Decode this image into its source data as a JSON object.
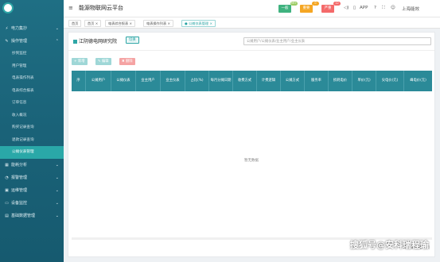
{
  "app": {
    "title": "能源物联网云平台"
  },
  "sidebar": {
    "top_items": [
      {
        "label": "电力集抄",
        "icon": "meter-icon"
      },
      {
        "label": "操作管理",
        "icon": "wrench-icon"
      }
    ],
    "sub_items": [
      {
        "label": "抄到监控"
      },
      {
        "label": "用户管理"
      },
      {
        "label": "电表操作列表"
      },
      {
        "label": "电表综合报表"
      },
      {
        "label": "订单信息"
      },
      {
        "label": "收入概况"
      },
      {
        "label": "购买记录查询"
      },
      {
        "label": "退款记录查询"
      },
      {
        "label": "公摊仪表管理"
      }
    ],
    "bottom_items": [
      {
        "label": "能耗分析",
        "icon": "chart-icon"
      },
      {
        "label": "报警管理",
        "icon": "bell-icon"
      },
      {
        "label": "运维管理",
        "icon": "tools-icon"
      },
      {
        "label": "设备监控",
        "icon": "monitor-icon"
      },
      {
        "label": "基础数据管理",
        "icon": "database-icon"
      }
    ]
  },
  "topbar": {
    "btn1": {
      "label": "一般",
      "badge": "99+",
      "color": "#3fb27f",
      "badge_color": "#9ccc65"
    },
    "btn2": {
      "label": "重要",
      "badge": "0",
      "color": "#f5a623",
      "badge_color": "#f5a623"
    },
    "btn3": {
      "label": "严重",
      "badge": "12",
      "color": "#f46a6a",
      "badge_color": "#f46a6a"
    },
    "app_label": "APP",
    "user": "上海能效"
  },
  "tabs": [
    {
      "label": "首页"
    },
    {
      "label": "首页 ×"
    },
    {
      "label": "电表综合报表 ×"
    },
    {
      "label": "电表操作列表 ×"
    },
    {
      "label": "● 公摊仪表管理 ×"
    }
  ],
  "panel": {
    "title": "江阴德电网研究院",
    "switch_label": "切换",
    "search_placeholder": "公摊用户/公摊仪表/业主用户/业主仪表",
    "actions": {
      "add": "+ 新增",
      "edit": "✎ 编辑",
      "delete": "✖ 删除"
    },
    "columns": [
      "序",
      "公摊用户",
      "公摊仪表",
      "业主用户",
      "业主仪表",
      "占比(%)",
      "每月分摊日期",
      "收费方式",
      "计费逻辑",
      "公摊方式",
      "服务率",
      "损耗电价",
      "单价(元)",
      "尖电价(元)",
      "峰电价(元)"
    ],
    "empty_text": "暂无数据",
    "pager_text": "共 0 条    前往 1 页"
  },
  "watermark": "搜狐号@安科瑞程瑜"
}
